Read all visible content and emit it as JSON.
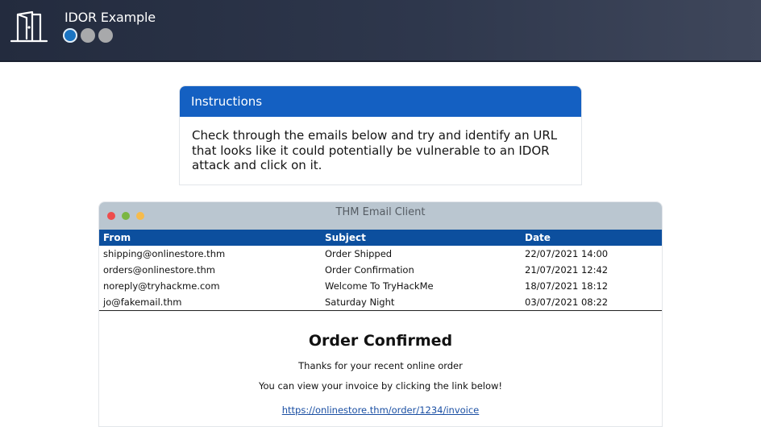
{
  "header": {
    "title": "IDOR Example",
    "logo_icon": "door-icon",
    "steps": [
      {
        "state": "active"
      },
      {
        "state": "inactive"
      },
      {
        "state": "inactive"
      }
    ]
  },
  "instructions": {
    "heading": "Instructions",
    "body": "Check through the emails below and try and identify an URL that looks like it could potentially be vulnerable to an IDOR attack and click on it."
  },
  "email_client": {
    "window_title": "THM Email Client",
    "columns": [
      "From",
      "Subject",
      "Date"
    ],
    "emails": [
      {
        "from": "shipping@onlinestore.thm",
        "subject": "Order Shipped",
        "date": "22/07/2021 14:00"
      },
      {
        "from": "orders@onlinestore.thm",
        "subject": "Order Confirmation",
        "date": "21/07/2021 12:42"
      },
      {
        "from": "noreply@tryhackme.com",
        "subject": "Welcome To TryHackMe",
        "date": "18/07/2021 18:12"
      },
      {
        "from": "jo@fakemail.thm",
        "subject": "Saturday Night",
        "date": "03/07/2021 08:22"
      }
    ],
    "message": {
      "heading": "Order Confirmed",
      "line1": "Thanks for your recent online order",
      "line2": "You can view your invoice by clicking the link below!",
      "link": "https://onlinestore.thm/order/1234/invoice"
    }
  },
  "colors": {
    "header_bg": "#2e374c",
    "instructions_header": "#1460c2",
    "table_header": "#0c4f9e",
    "active_step": "#1b74c2",
    "inactive_step": "#a8a9ab"
  }
}
